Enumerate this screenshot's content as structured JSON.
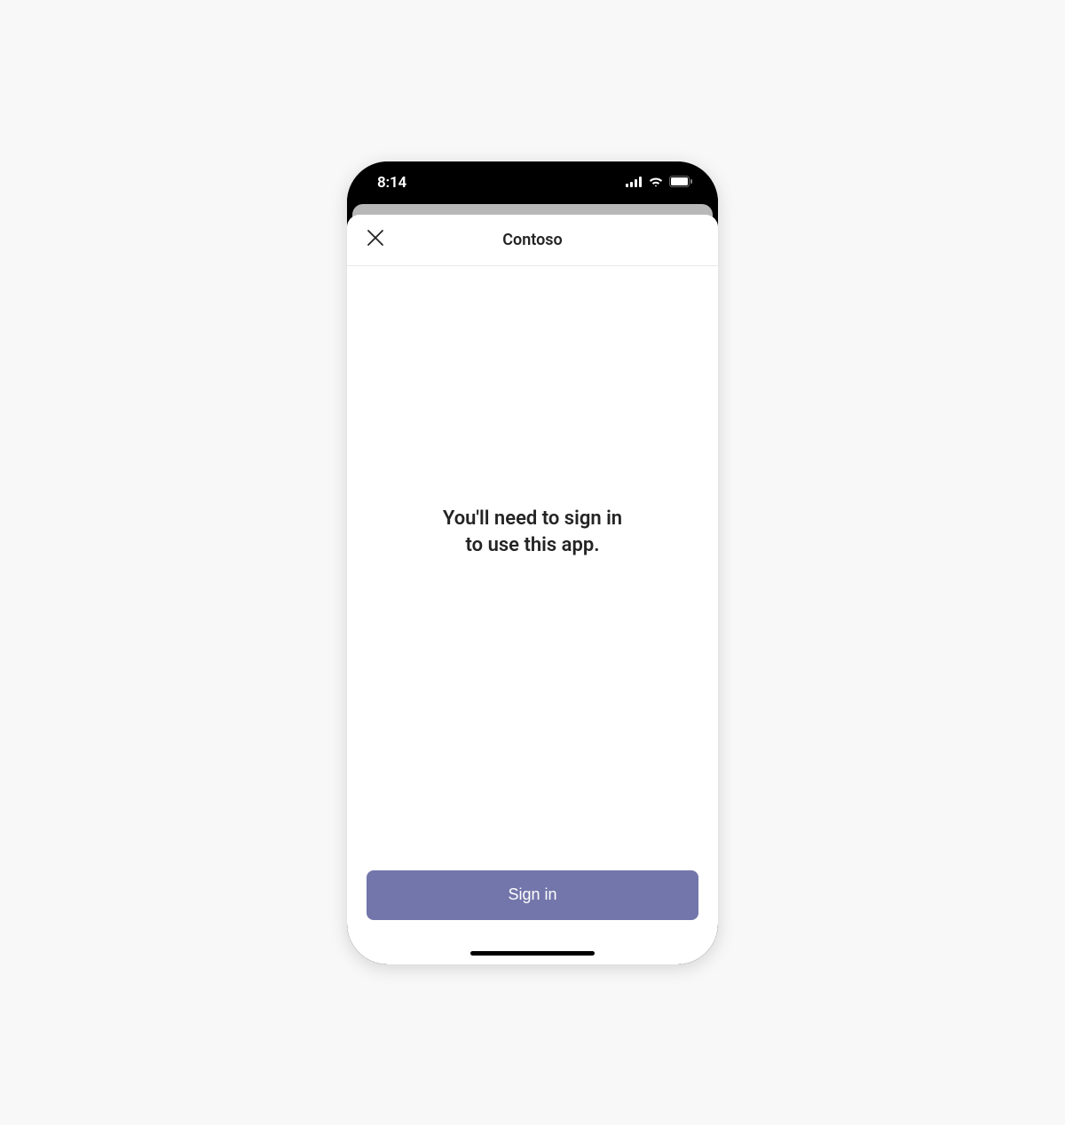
{
  "statusBar": {
    "time": "8:14"
  },
  "sheet": {
    "title": "Contoso",
    "message": "You'll need to sign in\nto use this app.",
    "signInLabel": "Sign in"
  },
  "colors": {
    "accent": "#7376aa",
    "background": "#f8f8f8"
  }
}
